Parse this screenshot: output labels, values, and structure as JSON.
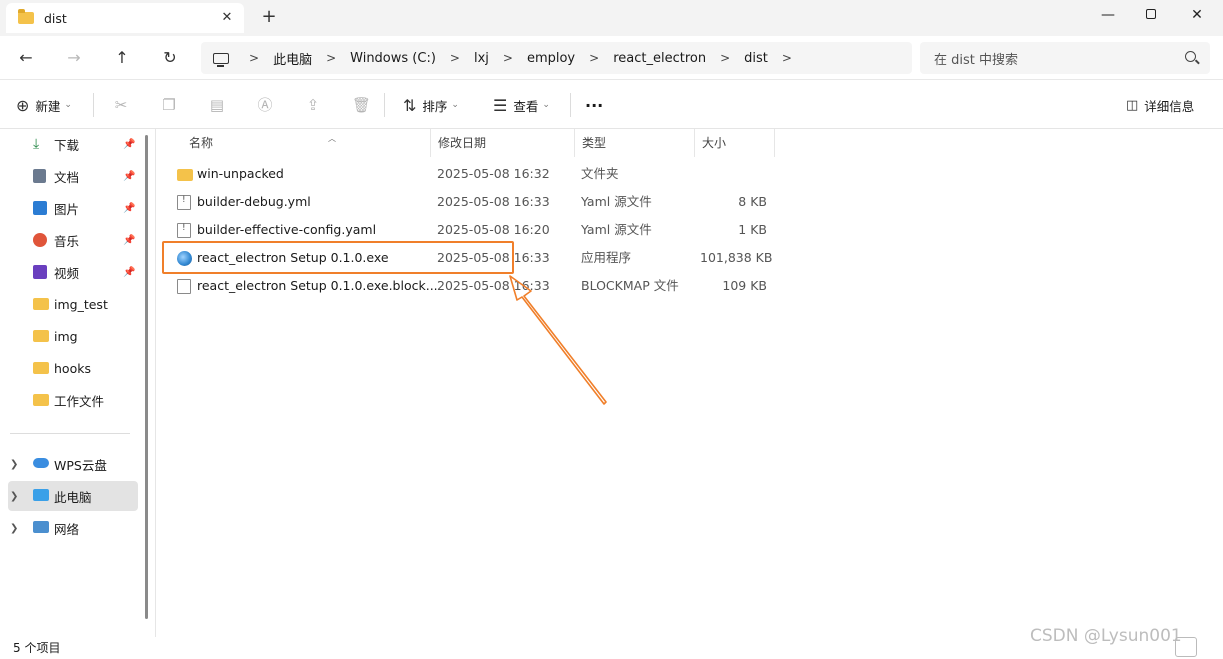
{
  "window": {
    "tab_title": "dist",
    "tab_close": "✕",
    "new_tab": "+",
    "minimize": "—",
    "close": "✕"
  },
  "nav": {
    "back": "←",
    "forward": "→",
    "up": "↑",
    "refresh": "↻",
    "breadcrumb": [
      "此电脑",
      "Windows (C:)",
      "lxj",
      "employ",
      "react_electron",
      "dist"
    ],
    "breadcrumb_sep": ">",
    "search_placeholder": "在 dist 中搜索"
  },
  "commandbar": {
    "new_label": "新建",
    "sort_label": "排序",
    "view_label": "查看",
    "more_label": "···",
    "details_label": "详细信息"
  },
  "sidebar": {
    "quick_access": [
      {
        "label": "下载",
        "icon": "download-icon",
        "pinned": true
      },
      {
        "label": "文档",
        "icon": "document-icon",
        "pinned": true
      },
      {
        "label": "图片",
        "icon": "pictures-icon",
        "pinned": true
      },
      {
        "label": "音乐",
        "icon": "music-icon",
        "pinned": true
      },
      {
        "label": "视频",
        "icon": "video-icon",
        "pinned": true
      },
      {
        "label": "img_test",
        "icon": "folder-icon",
        "pinned": false
      },
      {
        "label": "img",
        "icon": "folder-icon",
        "pinned": false
      },
      {
        "label": "hooks",
        "icon": "folder-icon",
        "pinned": false
      },
      {
        "label": "工作文件",
        "icon": "folder-icon",
        "pinned": false
      }
    ],
    "locations": [
      {
        "label": "WPS云盘",
        "icon": "cloud-icon",
        "selected": false
      },
      {
        "label": "此电脑",
        "icon": "computer-icon",
        "selected": true
      },
      {
        "label": "网络",
        "icon": "network-icon",
        "selected": false
      }
    ]
  },
  "file_list": {
    "columns": [
      "名称",
      "修改日期",
      "类型",
      "大小"
    ],
    "rows": [
      {
        "name": "win-unpacked",
        "date": "2025-05-08 16:32",
        "type": "文件夹",
        "size": "",
        "icon": "folder-icon"
      },
      {
        "name": "builder-debug.yml",
        "date": "2025-05-08 16:33",
        "type": "Yaml 源文件",
        "size": "8 KB",
        "icon": "yaml-file-icon"
      },
      {
        "name": "builder-effective-config.yaml",
        "date": "2025-05-08 16:20",
        "type": "Yaml 源文件",
        "size": "1 KB",
        "icon": "yaml-file-icon"
      },
      {
        "name": "react_electron Setup 0.1.0.exe",
        "date": "2025-05-08 16:33",
        "type": "应用程序",
        "size": "101,838 KB",
        "icon": "exe-installer-icon"
      },
      {
        "name": "react_electron Setup 0.1.0.exe.block...",
        "date": "2025-05-08 16:33",
        "type": "BLOCKMAP 文件",
        "size": "109 KB",
        "icon": "blank-file-icon"
      }
    ]
  },
  "status": {
    "item_count": "5 个项目"
  },
  "watermark": "CSDN @Lysun001",
  "colors": {
    "highlight": "#f07f2a",
    "folder": "#f4c24a"
  }
}
